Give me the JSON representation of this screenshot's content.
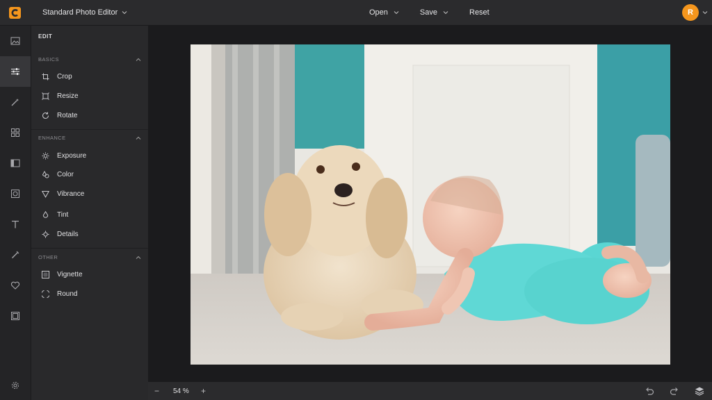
{
  "app": {
    "document_title": "Standard Photo Editor",
    "user_initial": "R",
    "accent_color": "#f5961d"
  },
  "toolbar": {
    "open_label": "Open",
    "save_label": "Save",
    "reset_label": "Reset"
  },
  "rail": {
    "items": [
      "image-icon",
      "adjust-sliders-icon",
      "magic-wand-icon",
      "grid-icon",
      "frame-layout-icon",
      "focus-icon",
      "text-icon",
      "brush-icon",
      "heart-icon",
      "border-icon",
      "gear-icon"
    ],
    "active": "adjust-sliders-icon"
  },
  "panel": {
    "title": "EDIT",
    "sections": [
      {
        "label": "BASICS",
        "tools": [
          "Crop",
          "Resize",
          "Rotate"
        ]
      },
      {
        "label": "ENHANCE",
        "tools": [
          "Exposure",
          "Color",
          "Vibrance",
          "Tint",
          "Details"
        ]
      },
      {
        "label": "OTHER",
        "tools": [
          "Vignette",
          "Round"
        ]
      }
    ]
  },
  "canvas": {
    "photo_subject": "baby and curly dog on carpet"
  },
  "bottombar": {
    "zoom_minus": "−",
    "zoom_value": "54 %",
    "zoom_plus": "+"
  }
}
